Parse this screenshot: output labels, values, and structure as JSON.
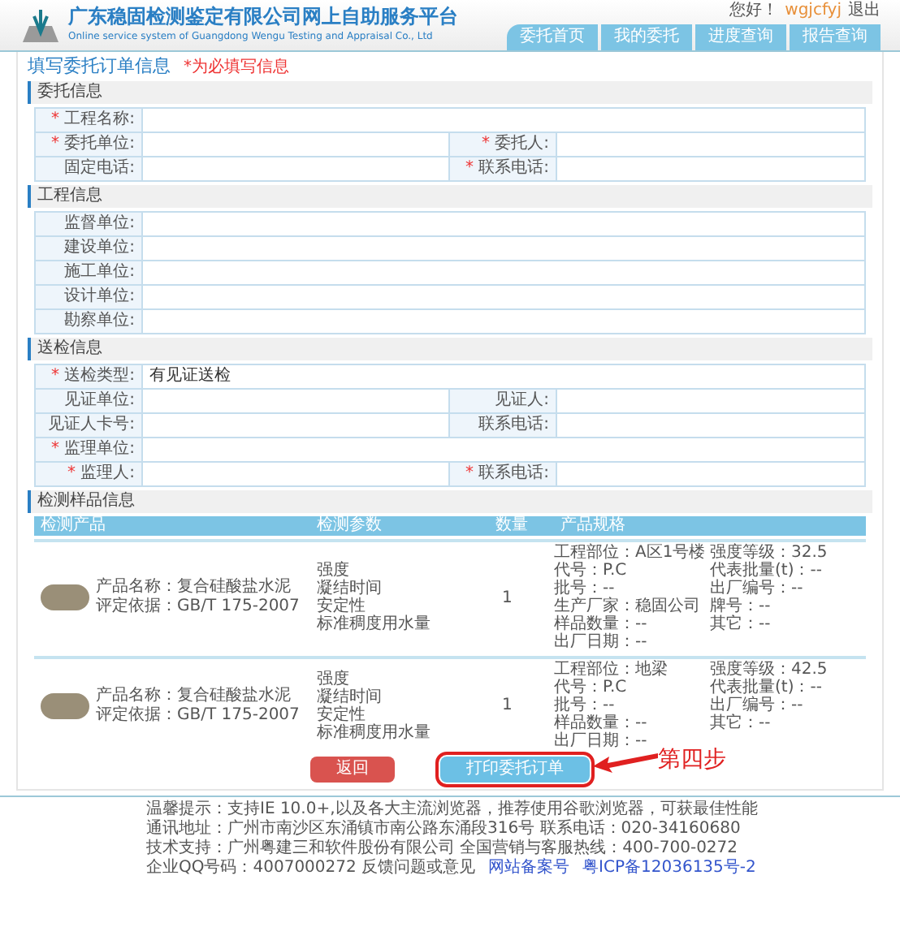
{
  "header": {
    "title": "广东稳固检测鉴定有限公司网上自助服务平台",
    "subtitle": "Online service system of Guangdong Wengu Testing and Appraisal Co., Ltd",
    "greeting": "您好！",
    "username": "wgjcfyj",
    "logout": "退出",
    "nav": [
      "委托首页",
      "我的委托",
      "进度查询",
      "报告查询"
    ]
  },
  "page_title": "填写委托订单信息",
  "required_note": "*为必填写信息",
  "sections": [
    {
      "title": "委托信息",
      "rows": [
        [
          {
            "label": "工程名称:",
            "mark": "*"
          }
        ],
        [
          {
            "label": "委托单位:",
            "mark": "*"
          },
          {
            "label": "委托人:",
            "mark": "*"
          }
        ],
        [
          {
            "label": "固定电话:"
          },
          {
            "label": "联系电话:",
            "mark": "*"
          }
        ]
      ]
    },
    {
      "title": "工程信息",
      "rows": [
        [
          {
            "label": "监督单位:"
          }
        ],
        [
          {
            "label": "建设单位:"
          }
        ],
        [
          {
            "label": "施工单位:"
          }
        ],
        [
          {
            "label": "设计单位:"
          }
        ],
        [
          {
            "label": "勘察单位:"
          }
        ]
      ]
    },
    {
      "title": "送检信息",
      "rows": [
        [
          {
            "label": "送检类型:",
            "mark": "*",
            "value": "有见证送检"
          }
        ],
        [
          {
            "label": "见证单位:"
          },
          {
            "label": "见证人:"
          }
        ],
        [
          {
            "label": "见证人卡号:"
          },
          {
            "label": "联系电话:"
          }
        ],
        [
          {
            "label": "监理单位:",
            "mark": "*"
          }
        ],
        [
          {
            "label": "监理人:",
            "mark": "*"
          },
          {
            "label": "联系电话:",
            "mark": "*"
          }
        ]
      ]
    }
  ],
  "samples": {
    "title": "检测样品信息",
    "columns": [
      "检测产品",
      "检测参数",
      "数量",
      "产品规格"
    ],
    "rows": [
      {
        "product": "产品名称：复合硅酸盐水泥",
        "standard": "评定依据：GB/T 175-2007",
        "params": [
          "强度",
          "凝结时间",
          "安定性",
          "标准稠度用水量"
        ],
        "quantity": "1",
        "specs": [
          "工程部位：A区1号楼",
          "强度等级：32.5",
          "代号：P.C",
          "代表批量(t)：--",
          "批号：--",
          "出厂编号：--",
          "生产厂家：稳固公司",
          "牌号：--",
          "样品数量：--",
          "其它：--",
          "出厂日期：--"
        ]
      },
      {
        "product": "产品名称：复合硅酸盐水泥",
        "standard": "评定依据：GB/T 175-2007",
        "params": [
          "强度",
          "凝结时间",
          "安定性",
          "标准稠度用水量"
        ],
        "quantity": "1",
        "specs": [
          "工程部位：地梁",
          "强度等级：42.5",
          "代号：P.C",
          "代表批量(t)：--",
          "批号：--",
          "出厂编号：--",
          "样品数量：--",
          "其它：--",
          "出厂日期：--"
        ]
      }
    ]
  },
  "buttons": [
    {
      "label": "返回",
      "kind": "back",
      "highlighted": false
    },
    {
      "label": "打印委托订单",
      "kind": "print",
      "highlighted": true
    }
  ],
  "annotation": {
    "text": "第四步"
  },
  "footer": {
    "lines": [
      {
        "text": "温馨提示：支持IE 10.0+,以及各大主流浏览器，推荐使用谷歌浏览器，可获最佳性能"
      },
      {
        "text": "通讯地址：广州市南沙区东涌镇市南公路东涌段316号 联系电话：020-34160680"
      },
      {
        "text": "技术支持：广州粤建三和软件股份有限公司 全国营销与客服热线：400-700-0272"
      },
      {
        "text": "企业QQ号码：4007000272  反馈问题或意见",
        "links": [
          "网站备案号",
          "粤ICP备12036135号-2"
        ]
      }
    ]
  }
}
